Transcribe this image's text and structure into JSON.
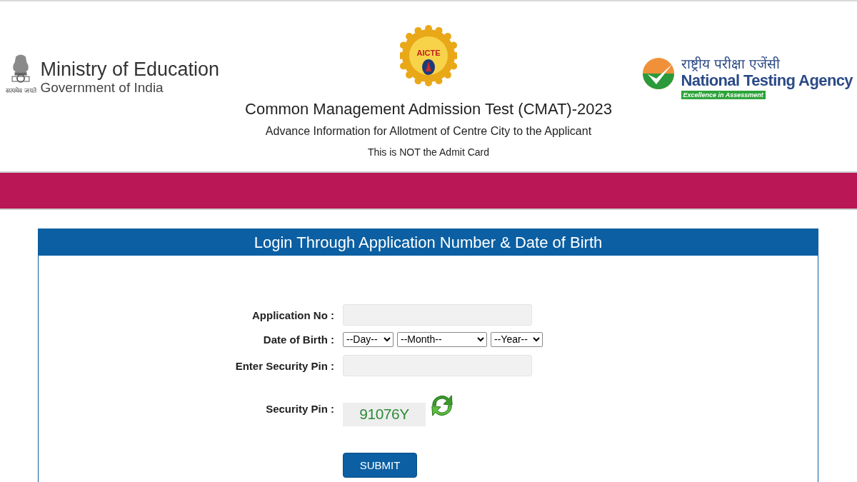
{
  "header": {
    "ministry": {
      "emblem_motto": "सत्यमेव जयते",
      "title": "Ministry of Education",
      "subtitle": "Government of India"
    },
    "aicte": {
      "label": "AICTE"
    },
    "nta": {
      "hindi_name": "राष्ट्रीय परीक्षा एजेंसी",
      "name": "National Testing Agency",
      "tagline": "Excellence in Assessment"
    },
    "title": "Common Management Admission Test (CMAT)-2023",
    "subtitle": "Advance Information for Allotment of Centre City to the Applicant",
    "notice": "This is NOT the Admit Card"
  },
  "login_panel": {
    "title": "Login Through Application Number & Date of Birth",
    "fields": [
      {
        "kind": "text",
        "label": "Application No :"
      },
      {
        "kind": "date",
        "label": "Date of Birth :",
        "selects": [
          "--Day--",
          "--Month--",
          "--Year--"
        ]
      },
      {
        "kind": "text",
        "label": "Enter Security Pin :"
      },
      {
        "kind": "captcha",
        "label": "Security Pin :",
        "code": "91076Y"
      }
    ],
    "submit": "SUBMIT"
  }
}
